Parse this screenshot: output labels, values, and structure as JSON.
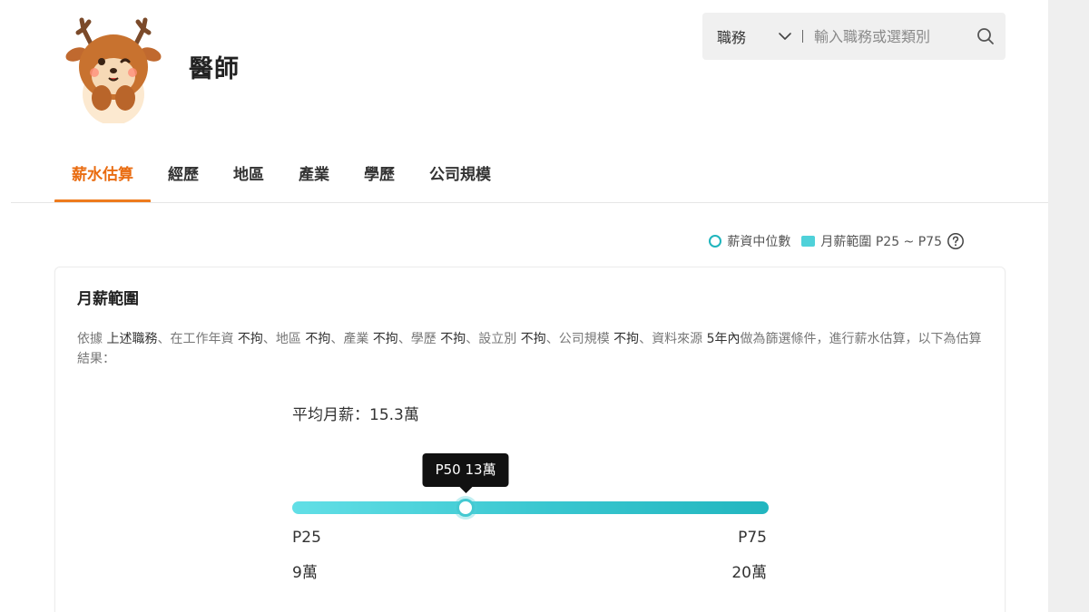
{
  "header": {
    "title": "醫師"
  },
  "search": {
    "category": "職務",
    "placeholder": "輸入職務或選類別"
  },
  "tabs": [
    {
      "label": "薪水估算",
      "active": true
    },
    {
      "label": "經歷",
      "active": false
    },
    {
      "label": "地區",
      "active": false
    },
    {
      "label": "產業",
      "active": false
    },
    {
      "label": "學歷",
      "active": false
    },
    {
      "label": "公司規模",
      "active": false
    }
  ],
  "legend": {
    "median_label": "薪資中位數",
    "range_label": "月薪範圍 P25 ~ P75"
  },
  "card": {
    "title": "月薪範圍",
    "description": [
      {
        "text": "依據 ",
        "highlight": false
      },
      {
        "text": "上述職務",
        "highlight": true
      },
      {
        "text": "、在工作年資 ",
        "highlight": false
      },
      {
        "text": "不拘",
        "highlight": true
      },
      {
        "text": "、地區 ",
        "highlight": false
      },
      {
        "text": "不拘",
        "highlight": true
      },
      {
        "text": "、產業 ",
        "highlight": false
      },
      {
        "text": "不拘",
        "highlight": true
      },
      {
        "text": "、學歷 ",
        "highlight": false
      },
      {
        "text": "不拘",
        "highlight": true
      },
      {
        "text": "、設立別 ",
        "highlight": false
      },
      {
        "text": "不拘",
        "highlight": true
      },
      {
        "text": "、公司規模 ",
        "highlight": false
      },
      {
        "text": "不拘",
        "highlight": true
      },
      {
        "text": "、資料來源 ",
        "highlight": false
      },
      {
        "text": "5年內",
        "highlight": true
      },
      {
        "text": "做為篩選條件，進行薪水估算，以下為估算結果：",
        "highlight": false
      }
    ],
    "average_label": "平均月薪：",
    "average_value": "15.3萬"
  },
  "salary_range": {
    "p25_label": "P25",
    "p25_value": "9萬",
    "p75_label": "P75",
    "p75_value": "20萬",
    "median_tooltip": "P50 13萬",
    "median_fraction": 0.364
  },
  "colors": {
    "accent": "#ee7b1d",
    "teal": "#1fb5bd",
    "bar_start": "#62dfe6",
    "bar_end": "#22b6bf"
  }
}
